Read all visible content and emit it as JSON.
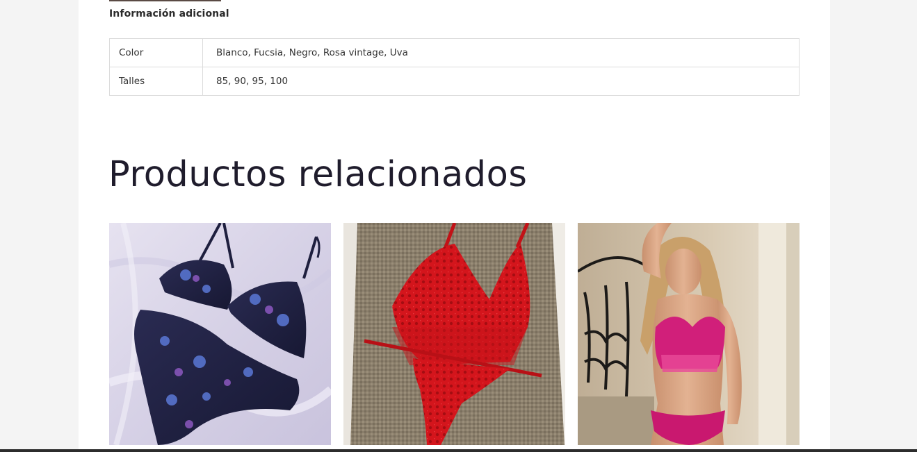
{
  "tabs": {
    "active_label": "Información adicional"
  },
  "attributes": {
    "rows": [
      {
        "label": "Color",
        "value": "Blanco, Fucsia, Negro, Rosa vintage, Uva"
      },
      {
        "label": "Talles",
        "value": "85, 90, 95, 100"
      }
    ]
  },
  "related": {
    "title": "Productos relacionados"
  },
  "colors": {
    "tab_underline": "#5a4a44",
    "title": "#1f1c2c",
    "border": "#dcdcdc"
  }
}
